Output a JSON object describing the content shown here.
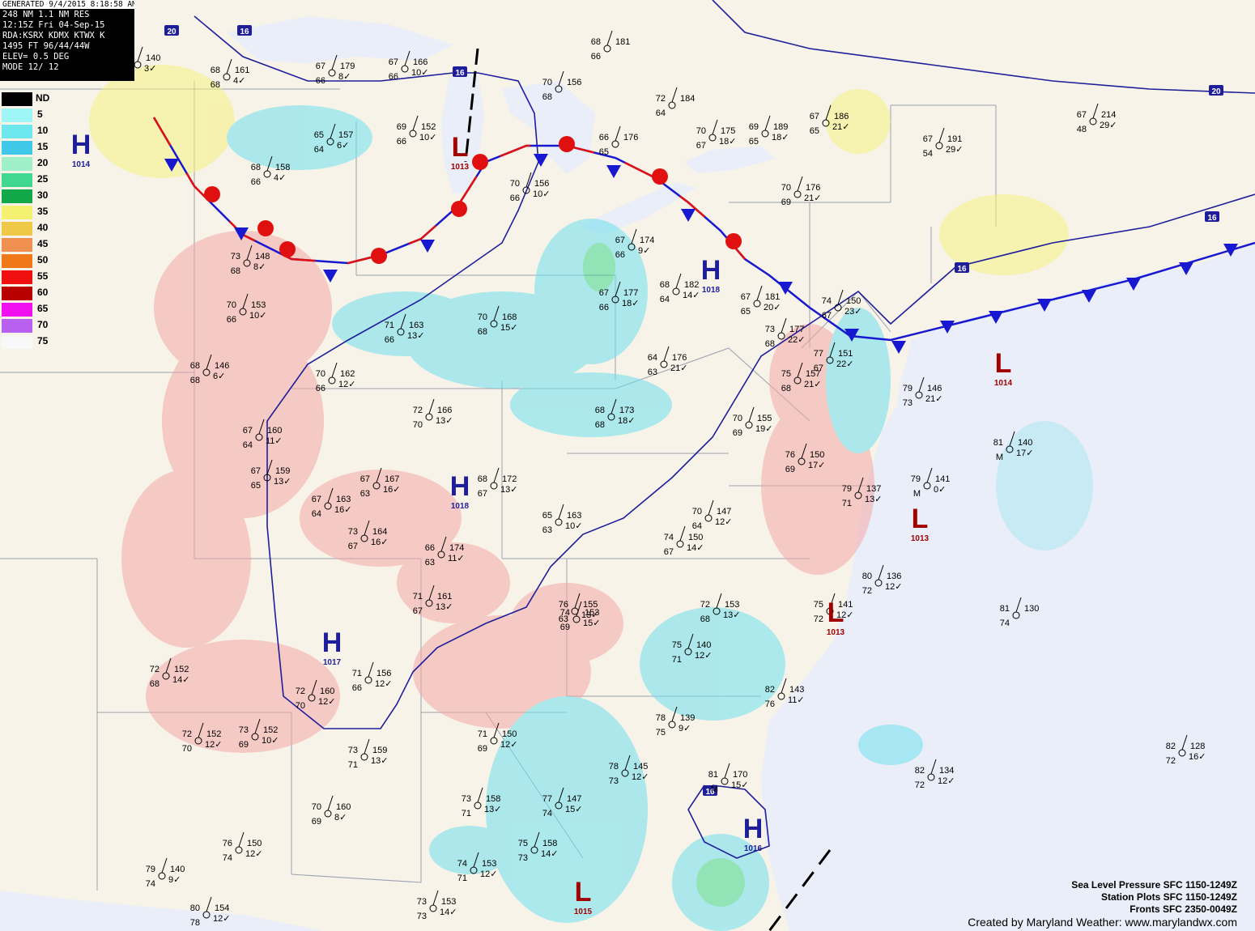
{
  "header": {
    "generated": "GENERATED 9/4/2015  8:18:58 AM EDT",
    "line1": "248 NM 1.1 NM RES",
    "line2": "12:15Z Fri 04-Sep-15",
    "line3": "RDA:KSRX KDMX KTWX K",
    "line4": "1495 FT  96/44/44W",
    "line5": "ELEV= 0.5 DEG",
    "line6": "MODE 12/ 12"
  },
  "legend": {
    "nd_label": "ND",
    "items": [
      {
        "label": "5",
        "color": "#9ff6f6"
      },
      {
        "label": "10",
        "color": "#6ee6ee"
      },
      {
        "label": "15",
        "color": "#40c8e8"
      },
      {
        "label": "20",
        "color": "#9ff0c8"
      },
      {
        "label": "25",
        "color": "#40d890"
      },
      {
        "label": "30",
        "color": "#10a848"
      },
      {
        "label": "35",
        "color": "#f4f070"
      },
      {
        "label": "40",
        "color": "#f0c848"
      },
      {
        "label": "45",
        "color": "#f09050"
      },
      {
        "label": "50",
        "color": "#f07818"
      },
      {
        "label": "55",
        "color": "#f01010"
      },
      {
        "label": "60",
        "color": "#b80000"
      },
      {
        "label": "65",
        "color": "#f010f0"
      },
      {
        "label": "70",
        "color": "#b860f0"
      },
      {
        "label": "75",
        "color": "#f8f8f8"
      }
    ]
  },
  "pressure_centers": [
    {
      "type": "H",
      "value": "1014",
      "color": "#1e1e9c"
    },
    {
      "type": "L",
      "value": "1013",
      "color": "#a00000"
    },
    {
      "type": "H",
      "value": "1018",
      "color": "#1e1e9c"
    },
    {
      "type": "H",
      "value": "1018",
      "color": "#1e1e9c"
    },
    {
      "type": "H",
      "value": "1017",
      "color": "#1e1e9c"
    },
    {
      "type": "L",
      "value": "1014",
      "color": "#a00000"
    },
    {
      "type": "L",
      "value": "1013",
      "color": "#a00000"
    },
    {
      "type": "L",
      "value": "1013",
      "color": "#a00000"
    },
    {
      "type": "H",
      "value": "1016",
      "color": "#1e1e9c"
    },
    {
      "type": "L",
      "value": "1015",
      "color": "#a00000"
    }
  ],
  "isobar_labels": [
    "16",
    "20",
    "20",
    "16",
    "12",
    "16",
    "16",
    "16"
  ],
  "stations": [
    {
      "t": "70",
      "td": "70",
      "p": "140",
      "dp": "3"
    },
    {
      "t": "68",
      "td": "68",
      "p": "161",
      "dp": "4"
    },
    {
      "t": "67",
      "td": "66",
      "p": "179",
      "dp": "8"
    },
    {
      "t": "67",
      "td": "66",
      "p": "166",
      "dp": "10"
    },
    {
      "t": "69",
      "td": "66",
      "p": "152",
      "dp": "10"
    },
    {
      "t": "68",
      "td": "66",
      "p": "181",
      "dp": ""
    },
    {
      "t": "70",
      "td": "68",
      "p": "156",
      "dp": ""
    },
    {
      "t": "72",
      "td": "64",
      "p": "184",
      "dp": ""
    },
    {
      "t": "70",
      "td": "67",
      "p": "175",
      "dp": "18"
    },
    {
      "t": "69",
      "td": "65",
      "p": "189",
      "dp": "18"
    },
    {
      "t": "67",
      "td": "54",
      "p": "191",
      "dp": "29"
    },
    {
      "t": "67",
      "td": "48",
      "p": "214",
      "dp": "29"
    },
    {
      "t": "68",
      "td": "66",
      "p": "158",
      "dp": "4"
    },
    {
      "t": "65",
      "td": "64",
      "p": "157",
      "dp": "6"
    },
    {
      "t": "70",
      "td": "66",
      "p": "156",
      "dp": "10"
    },
    {
      "t": "66",
      "td": "65",
      "p": "176",
      "dp": ""
    },
    {
      "t": "67",
      "td": "66",
      "p": "174",
      "dp": "9"
    },
    {
      "t": "68",
      "td": "64",
      "p": "182",
      "dp": "14"
    },
    {
      "t": "70",
      "td": "69",
      "p": "176",
      "dp": "21"
    },
    {
      "t": "67",
      "td": "65",
      "p": "186",
      "dp": "21"
    },
    {
      "t": "73",
      "td": "68",
      "p": "148",
      "dp": "8"
    },
    {
      "t": "70",
      "td": "66",
      "p": "153",
      "dp": "10"
    },
    {
      "t": "71",
      "td": "66",
      "p": "163",
      "dp": "13"
    },
    {
      "t": "70",
      "td": "68",
      "p": "168",
      "dp": "15"
    },
    {
      "t": "67",
      "td": "66",
      "p": "177",
      "dp": "18"
    },
    {
      "t": "67",
      "td": "65",
      "p": "181",
      "dp": "20"
    },
    {
      "t": "73",
      "td": "68",
      "p": "177",
      "dp": "22"
    },
    {
      "t": "74",
      "td": "67",
      "p": "150",
      "dp": "23"
    },
    {
      "t": "68",
      "td": "68",
      "p": "146",
      "dp": "6"
    },
    {
      "t": "70",
      "td": "66",
      "p": "162",
      "dp": "12"
    },
    {
      "t": "67",
      "td": "64",
      "p": "160",
      "dp": "11"
    },
    {
      "t": "72",
      "td": "70",
      "p": "166",
      "dp": "13"
    },
    {
      "t": "68",
      "td": "68",
      "p": "173",
      "dp": "18"
    },
    {
      "t": "64",
      "td": "63",
      "p": "176",
      "dp": "21"
    },
    {
      "t": "77",
      "td": "67",
      "p": "151",
      "dp": "22"
    },
    {
      "t": "75",
      "td": "68",
      "p": "157",
      "dp": "21"
    },
    {
      "t": "67",
      "td": "65",
      "p": "159",
      "dp": "13"
    },
    {
      "t": "67",
      "td": "64",
      "p": "163",
      "dp": "16"
    },
    {
      "t": "67",
      "td": "63",
      "p": "167",
      "dp": "16"
    },
    {
      "t": "68",
      "td": "67",
      "p": "172",
      "dp": "13"
    },
    {
      "t": "70",
      "td": "69",
      "p": "155",
      "dp": "19"
    },
    {
      "t": "76",
      "td": "69",
      "p": "150",
      "dp": "17"
    },
    {
      "t": "73",
      "td": "67",
      "p": "164",
      "dp": "16"
    },
    {
      "t": "66",
      "td": "63",
      "p": "174",
      "dp": "11"
    },
    {
      "t": "65",
      "td": "63",
      "p": "163",
      "dp": "10"
    },
    {
      "t": "70",
      "td": "64",
      "p": "147",
      "dp": "12"
    },
    {
      "t": "74",
      "td": "67",
      "p": "150",
      "dp": "14"
    },
    {
      "t": "79",
      "td": "71",
      "p": "137",
      "dp": "13"
    },
    {
      "t": "74",
      "td": "69",
      "p": "153",
      "dp": "15"
    },
    {
      "t": "71",
      "td": "67",
      "p": "161",
      "dp": "13"
    },
    {
      "t": "76",
      "td": "63",
      "p": "155",
      "dp": "13"
    },
    {
      "t": "75",
      "td": "72",
      "p": "141",
      "dp": "12"
    },
    {
      "t": "80",
      "td": "72",
      "p": "136",
      "dp": "12"
    },
    {
      "t": "72",
      "td": "68",
      "p": "152",
      "dp": "14"
    },
    {
      "t": "72",
      "td": "70",
      "p": "160",
      "dp": "12"
    },
    {
      "t": "71",
      "td": "66",
      "p": "156",
      "dp": "12"
    },
    {
      "t": "72",
      "td": "68",
      "p": "153",
      "dp": "13"
    },
    {
      "t": "75",
      "td": "71",
      "p": "140",
      "dp": "12"
    },
    {
      "t": "82",
      "td": "76",
      "p": "143",
      "dp": "11"
    },
    {
      "t": "72",
      "td": "70",
      "p": "152",
      "dp": "12"
    },
    {
      "t": "73",
      "td": "69",
      "p": "152",
      "dp": "10"
    },
    {
      "t": "71",
      "td": "69",
      "p": "150",
      "dp": "12"
    },
    {
      "t": "78",
      "td": "75",
      "p": "139",
      "dp": "9"
    },
    {
      "t": "81",
      "td": "74",
      "p": "130",
      "dp": ""
    },
    {
      "t": "73",
      "td": "71",
      "p": "159",
      "dp": "13"
    },
    {
      "t": "70",
      "td": "69",
      "p": "160",
      "dp": "8"
    },
    {
      "t": "73",
      "td": "71",
      "p": "158",
      "dp": "13"
    },
    {
      "t": "77",
      "td": "74",
      "p": "147",
      "dp": "15"
    },
    {
      "t": "78",
      "td": "73",
      "p": "145",
      "dp": "12"
    },
    {
      "t": "82",
      "td": "72",
      "p": "134",
      "dp": "12"
    },
    {
      "t": "82",
      "td": "72",
      "p": "128",
      "dp": "16"
    },
    {
      "t": "81",
      "td": "M",
      "p": "170",
      "dp": "15"
    },
    {
      "t": "75",
      "td": "73",
      "p": "158",
      "dp": "14"
    },
    {
      "t": "74",
      "td": "71",
      "p": "153",
      "dp": "12"
    },
    {
      "t": "76",
      "td": "74",
      "p": "150",
      "dp": "12"
    },
    {
      "t": "79",
      "td": "74",
      "p": "140",
      "dp": "9"
    },
    {
      "t": "80",
      "td": "78",
      "p": "154",
      "dp": "12"
    },
    {
      "t": "73",
      "td": "73",
      "p": "153",
      "dp": "14"
    },
    {
      "t": "81",
      "td": "M",
      "p": "140",
      "dp": "17"
    },
    {
      "t": "79",
      "td": "M",
      "p": "141",
      "dp": "0"
    },
    {
      "t": "79",
      "td": "73",
      "p": "146",
      "dp": "21"
    }
  ],
  "footer": {
    "line1": "Sea Level Pressure SFC 1150-1249Z",
    "line2": "Station Plots SFC 1150-1249Z",
    "line3": "Fronts SFC 2350-0049Z",
    "line4": "Created by Maryland Weather: www.marylandwx.com"
  }
}
